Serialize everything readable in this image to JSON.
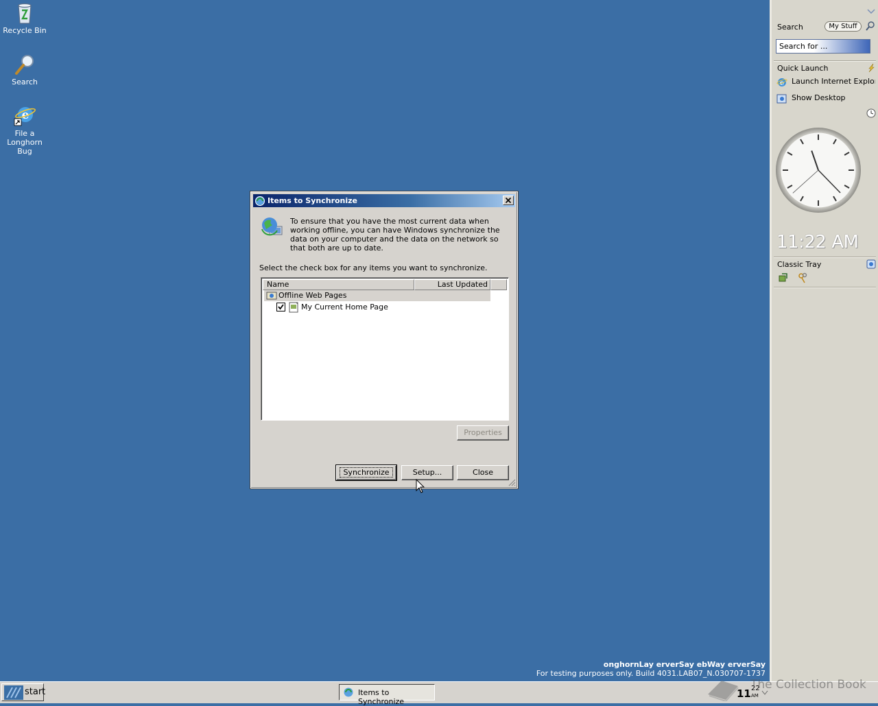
{
  "desktop": {
    "icons": [
      {
        "label": "Recycle Bin"
      },
      {
        "label": "Search"
      },
      {
        "label_line1": "File a",
        "label_line2": "Longhorn Bug"
      }
    ],
    "watermark": {
      "line1": "onghornLay erverSay ebWay erverSay",
      "line2": "For testing purposes only. Build 4031.LAB07_N.030707-1737"
    },
    "overlay_brand": "The Collection Book"
  },
  "sidebar": {
    "search": {
      "title": "Search",
      "scope_button": "My Stuff",
      "input_value": "Search for ..."
    },
    "quick_launch": {
      "title": "Quick Launch",
      "items": [
        {
          "label": "Launch Internet Explorer"
        },
        {
          "label": "Show Desktop"
        }
      ]
    },
    "clock": {
      "time_text": "11:22 AM",
      "hour": 11,
      "minute": 22,
      "second": 38
    },
    "classic_tray": {
      "title": "Classic Tray"
    }
  },
  "dialog": {
    "title": "Items to Synchronize",
    "intro": "To ensure that you have the most current data when working offline, you can have Windows synchronize the data on your computer and the data on the network so that both are up to date.",
    "instruction": "Select the check box for any items you want to synchronize.",
    "list": {
      "columns": [
        "Name",
        "Last Updated"
      ],
      "group": {
        "label": "Offline Web Pages"
      },
      "items": [
        {
          "label": "My Current Home Page",
          "checked": true
        }
      ]
    },
    "buttons": {
      "properties": "Properties",
      "synchronize": "Synchronize",
      "setup": "Setup...",
      "close": "Close"
    }
  },
  "taskbar": {
    "start_label": "start",
    "task_label": "Items to Synchronize",
    "clock_hour": "11",
    "clock_minute": "22",
    "clock_ampm": "AM"
  },
  "colors": {
    "desktop": "#3b6ea5",
    "title_gradient_start": "#0a246a",
    "title_gradient_end": "#a6caf0"
  }
}
